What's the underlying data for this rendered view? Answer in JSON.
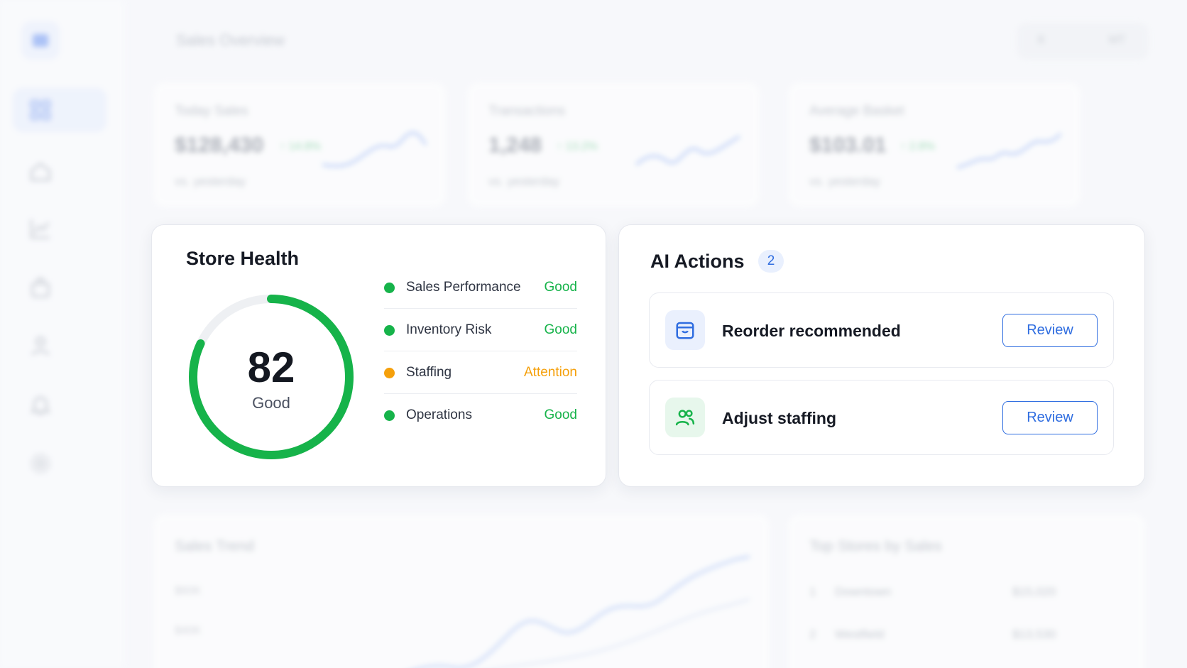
{
  "background": {
    "page_title": "Sales Overview",
    "topbar": {
      "a": "8",
      "b": "MT"
    },
    "kpis": [
      {
        "label": "Today Sales",
        "value": "$128,430",
        "delta": "↑ 14.8%",
        "sub": "vs. yesterday"
      },
      {
        "label": "Transactions",
        "value": "1,248",
        "delta": "↑ 13.2%",
        "sub": "vs. yesterday"
      },
      {
        "label": "Average Basket",
        "value": "$103.01",
        "delta": "↑ 2.8%",
        "sub": "vs. yesterday"
      }
    ],
    "sales_trend": {
      "title": "Sales Trend",
      "axis": [
        "$60K",
        "$40K"
      ]
    },
    "top_stores": {
      "title": "Top Stores by Sales",
      "rows": [
        {
          "rank": "1",
          "name": "Downtown",
          "value": "$15,020"
        },
        {
          "rank": "2",
          "name": "Westfield",
          "value": "$13,530"
        }
      ]
    }
  },
  "store_health": {
    "title": "Store Health",
    "score": "82",
    "score_fraction": 0.82,
    "score_label": "Good",
    "metrics": [
      {
        "name": "Sales Performance",
        "status": "Good",
        "color": "#16b34a"
      },
      {
        "name": "Inventory Risk",
        "status": "Good",
        "color": "#16b34a"
      },
      {
        "name": "Staffing",
        "status": "Attention",
        "color": "#f5a00b"
      },
      {
        "name": "Operations",
        "status": "Good",
        "color": "#16b34a"
      }
    ],
    "gauge_color": "#16b34a",
    "track_color": "#eef0f3"
  },
  "ai_actions": {
    "title": "AI Actions",
    "count": "2",
    "items": [
      {
        "title": "Reorder recommended",
        "button": "Review",
        "icon": "box-icon"
      },
      {
        "title": "Adjust staffing",
        "button": "Review",
        "icon": "users-icon"
      }
    ]
  },
  "colors": {
    "accent": "#2f6de0",
    "good": "#16b34a",
    "attention": "#f5a00b"
  }
}
